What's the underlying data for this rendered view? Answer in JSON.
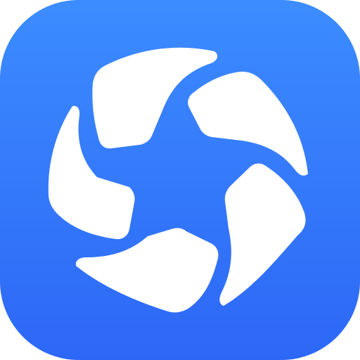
{
  "icon": {
    "name": "pinwheel-star-app-icon",
    "tile_color_top": "#3C8CFF",
    "tile_color_bottom": "#2D67F6",
    "glyph_color": "#FFFFFF"
  }
}
